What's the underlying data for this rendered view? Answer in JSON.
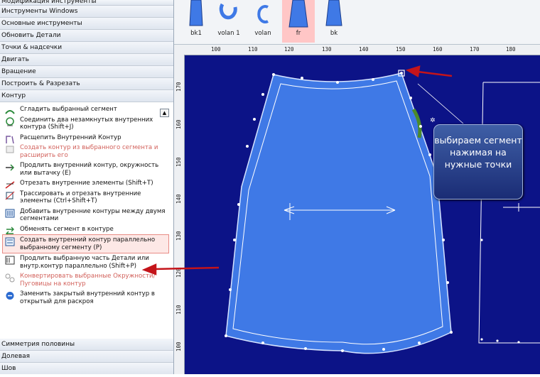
{
  "left_panel": {
    "categories_top": [
      "Модификация инструменты",
      "Инструменты Windows",
      "Основные инструменты",
      "Обновить Детали",
      "Точки & надсечки",
      "Двигать",
      "Вращение",
      "Построить & Разрезать",
      "Контур"
    ],
    "commands": [
      {
        "label": "Сгладить выбранный сегмент",
        "icon": "smooth-segment-icon"
      },
      {
        "label": "Соединить два незамкнутых внутренних контура (Shift+J)",
        "icon": "join-contours-icon"
      },
      {
        "label": "Расщепить Внутренний Контур",
        "icon": "split-contour-icon"
      },
      {
        "label": "Создать контур из выбранного сегмента и расширить его",
        "icon": "contour-from-segment-icon"
      },
      {
        "label": "Продлить внутренний контур, окружность или вытачку (E)",
        "icon": "extend-contour-icon"
      },
      {
        "label": "Отрезать внутренние элементы (Shift+T)",
        "icon": "cut-elements-icon"
      },
      {
        "label": "Трассировать и отрезать внутренние элементы (Ctrl+Shift+T)",
        "icon": "trace-cut-icon"
      },
      {
        "label": "Добавить внутренние контуры между двумя сегментами",
        "icon": "add-contours-icon"
      },
      {
        "label": "Обменять сегмент в контуре",
        "icon": "swap-segment-icon"
      },
      {
        "label": "Создать внутренний контур параллельно выбранному сегменту (P)",
        "icon": "parallel-contour-icon"
      },
      {
        "label": "Продлить выбранную часть Детали или внутр.контур параллельно (Shift+P)",
        "icon": "extend-parallel-icon"
      },
      {
        "label": "Конвертировать выбранные Окружности/Пуговицы на контур",
        "icon": "convert-circles-icon"
      },
      {
        "label": "Заменить закрытый внутренний контур в открытый для раскроя",
        "icon": "replace-contour-icon"
      }
    ],
    "categories_bottom": [
      "Симметрия половины",
      "Долевая",
      "Шов"
    ]
  },
  "pieces": [
    {
      "label": "bk1",
      "icon": "bodice-piece-icon"
    },
    {
      "label": "volan 1",
      "icon": "ruffle-piece-icon"
    },
    {
      "label": "volan",
      "icon": "ruffle-piece-icon"
    },
    {
      "label": "fr",
      "icon": "skirt-front-piece-icon"
    },
    {
      "label": "bk",
      "icon": "skirt-back-piece-icon"
    }
  ],
  "ruler_top": [
    "100",
    "110",
    "120",
    "130",
    "140",
    "150",
    "160",
    "170",
    "180"
  ],
  "ruler_left": [
    "170",
    "160",
    "150",
    "140",
    "130",
    "120",
    "110",
    "100"
  ],
  "callout_text": "выбираем сегмент нажимая на нужные точки",
  "colors": {
    "canvas_bg": "#0c1387",
    "piece_fill": "#3f79e6",
    "selected_piece_bg": "#ffc6c6",
    "annotation_arrow": "#c4141a",
    "disabled_text": "#d2615b"
  }
}
